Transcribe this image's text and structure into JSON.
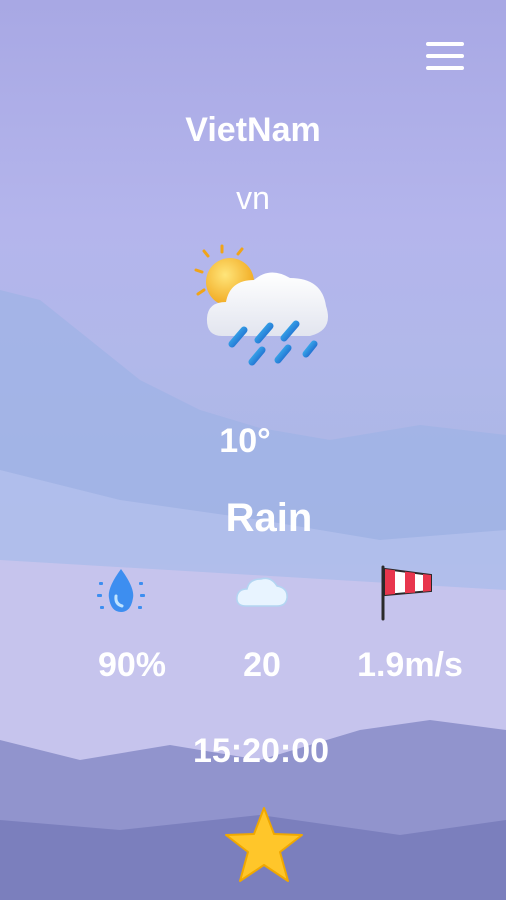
{
  "header": {
    "menu_icon": "hamburger-menu-icon"
  },
  "location": {
    "city": "VietNam",
    "country_code": "vn"
  },
  "current": {
    "condition_icon": "sun-behind-rain-cloud-icon",
    "temperature": "10°",
    "description": "Rain"
  },
  "stats": [
    {
      "icon": "humidity-drop-icon",
      "value": "90%"
    },
    {
      "icon": "cloud-icon",
      "value": "20"
    },
    {
      "icon": "windsock-icon",
      "value": "1.9m/s"
    }
  ],
  "time": "15:20:00",
  "favorite": {
    "icon": "star-icon",
    "color": "#ffc62a"
  }
}
